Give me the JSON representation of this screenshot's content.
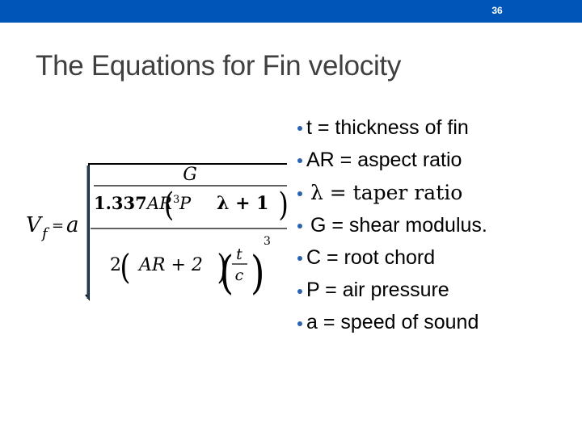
{
  "slide_number": "36",
  "title": "The Equations for Fin velocity",
  "formula": {
    "lhs_var": "V",
    "lhs_sub": "f",
    "equals": "=",
    "coef": "a",
    "inner_numerator": "G",
    "inner_denominator_coef": "1.337",
    "inner_denominator_ar": "AR",
    "inner_denominator_exp": "3",
    "inner_denominator_p": "P",
    "lambda_term": "λ + 1",
    "outer_denominator_two": "2",
    "ar_term": "AR + 2",
    "frac_top": "t",
    "frac_bottom": "c",
    "outer_exponent": "3"
  },
  "bullets": [
    {
      "text": "t = thickness of fin"
    },
    {
      "text": "AR = aspect ratio"
    },
    {
      "text": "λ = taper ratio"
    },
    {
      "text": "G = shear modulus."
    },
    {
      "text": "C = root chord"
    },
    {
      "text": "P = air pressure"
    },
    {
      "text": "a = speed of sound"
    }
  ],
  "colors": {
    "header_bar": "#0056b8",
    "bullet": "#2a62b6",
    "title": "#404040"
  }
}
